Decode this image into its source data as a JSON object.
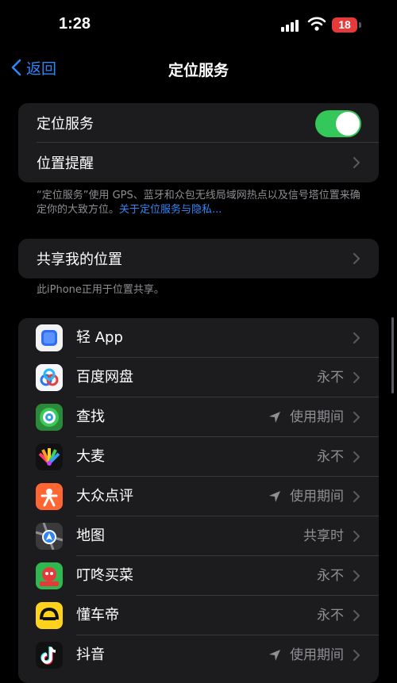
{
  "status": {
    "time": "1:28",
    "battery": "18"
  },
  "nav": {
    "back_label": "返回",
    "title": "定位服务"
  },
  "location_group": {
    "location_services_label": "定位服务",
    "location_services_on": true,
    "location_alerts_label": "位置提醒"
  },
  "location_note": {
    "text": "“定位服务”使用 GPS、蓝牙和众包无线局域网热点以及信号塔位置来确定你的大致方位。",
    "link": "关于定位服务与隐私..."
  },
  "share_group": {
    "label": "共享我的位置"
  },
  "share_note": "此iPhone正用于位置共享。",
  "apps": [
    {
      "name": "轻 App",
      "value": "",
      "arrow": false,
      "icon": "light-app-icon"
    },
    {
      "name": "百度网盘",
      "value": "永不",
      "arrow": false,
      "icon": "baidu-netdisk-icon"
    },
    {
      "name": "查找",
      "value": "使用期间",
      "arrow": true,
      "icon": "find-my-icon"
    },
    {
      "name": "大麦",
      "value": "永不",
      "arrow": false,
      "icon": "damai-icon"
    },
    {
      "name": "大众点评",
      "value": "使用期间",
      "arrow": true,
      "icon": "dianping-icon"
    },
    {
      "name": "地图",
      "value": "共享时",
      "arrow": false,
      "icon": "maps-icon"
    },
    {
      "name": "叮咚买菜",
      "value": "永不",
      "arrow": false,
      "icon": "dingdong-icon"
    },
    {
      "name": "懂车帝",
      "value": "永不",
      "arrow": false,
      "icon": "dongchedi-icon"
    },
    {
      "name": "抖音",
      "value": "使用期间",
      "arrow": true,
      "icon": "douyin-icon"
    }
  ],
  "colors": {
    "accent": "#2f86f6",
    "toggle_on": "#34c759",
    "cell_bg": "#1c1c1e",
    "secondary_text": "#8e8e93"
  }
}
